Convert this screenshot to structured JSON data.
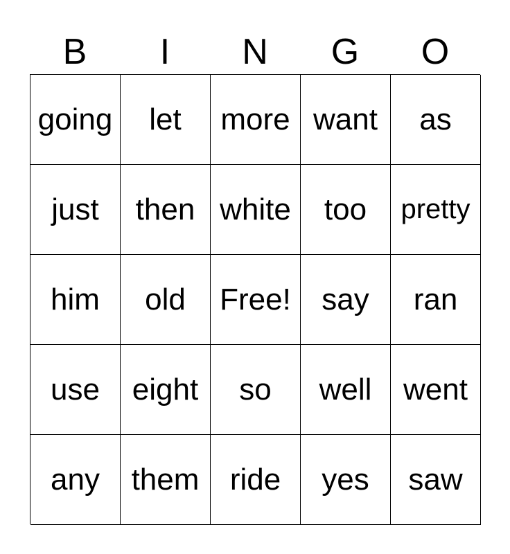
{
  "header": [
    "B",
    "I",
    "N",
    "G",
    "O"
  ],
  "cells": [
    [
      "going",
      "let",
      "more",
      "want",
      "as"
    ],
    [
      "just",
      "then",
      "white",
      "too",
      "pretty"
    ],
    [
      "him",
      "old",
      "Free!",
      "say",
      "ran"
    ],
    [
      "use",
      "eight",
      "so",
      "well",
      "went"
    ],
    [
      "any",
      "them",
      "ride",
      "yes",
      "saw"
    ]
  ]
}
